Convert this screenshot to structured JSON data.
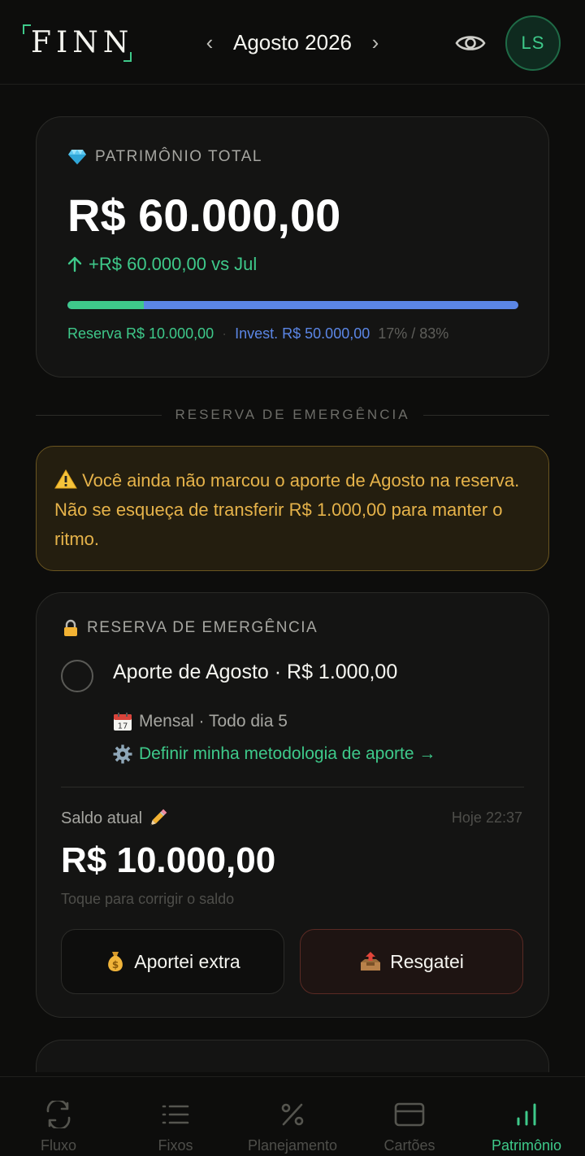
{
  "header": {
    "logo": "FINN",
    "month": "Agosto 2026",
    "prev_symbol": "‹",
    "next_symbol": "›",
    "avatar_initials": "LS"
  },
  "total": {
    "label": "PATRIMÔNIO TOTAL",
    "amount": "R$ 60.000,00",
    "change": "+R$ 60.000,00 vs Jul",
    "reserve_fraction": 0.17,
    "legend_reserve": "Reserva R$ 10.000,00",
    "legend_sep": "·",
    "legend_invest": "Invest. R$ 50.000,00",
    "legend_pct": "17% / 83%"
  },
  "section": {
    "title": "RESERVA DE EMERGÊNCIA"
  },
  "warning": {
    "text": "Você ainda não marcou o aporte de Agosto na reserva. Não se esqueça de transferir R$ 1.000,00 para manter o ritmo."
  },
  "reserve": {
    "label": "RESERVA DE EMERGÊNCIA",
    "title": "Aporte de Agosto · R$ 1.000,00",
    "frequency": "Mensal · Todo dia 5",
    "method_link": "Definir minha metodologia de aporte →",
    "balance_label": "Saldo atual",
    "balance_time": "Hoje 22:37",
    "balance_amount": "R$ 10.000,00",
    "balance_hint": "Toque para corrigir o saldo",
    "btn_extra": "Aportei extra",
    "btn_withdraw": "Resgatei"
  },
  "nav": {
    "items": [
      {
        "label": "Fluxo"
      },
      {
        "label": "Fixos"
      },
      {
        "label": "Planejamento"
      },
      {
        "label": "Cartões"
      },
      {
        "label": "Patrimônio"
      }
    ]
  },
  "colors": {
    "accent_green": "#3ec98a",
    "accent_blue": "#5b86e5",
    "warning": "#e6b34a",
    "background": "#0d0d0c"
  }
}
